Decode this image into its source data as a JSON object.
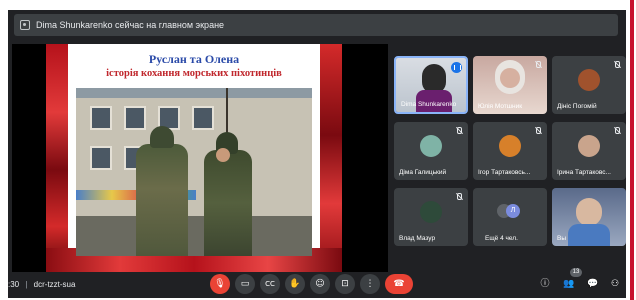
{
  "notification": {
    "text": "Dima Shunkarenko сейчас на главном экране"
  },
  "slide": {
    "title": "Руслан та Олена",
    "subtitle": "історія кохання морських піхотинців"
  },
  "participants": [
    {
      "name": "Dima Shunkarenko",
      "speaking": true
    },
    {
      "name": "Юлія Мотшник",
      "speaking": false
    },
    {
      "name": "Дініс Погомій",
      "speaking": false
    },
    {
      "name": "Діма Галицький",
      "speaking": false
    },
    {
      "name": "Ігор Тартаковсь...",
      "speaking": false
    },
    {
      "name": "Ірина Тартаковс...",
      "speaking": false
    },
    {
      "name": "Влад Мазур",
      "speaking": false
    },
    {
      "name": "Ещё 4 чел.",
      "speaking": false
    },
    {
      "name": "Вы",
      "speaking": false
    }
  ],
  "more_badge_letter": "Л",
  "meeting": {
    "time": ":30",
    "code": "dcr-tzzt-sua"
  },
  "controls": {
    "participants_count": "13"
  },
  "colors": {
    "background": "#202124",
    "tile": "#3c4043",
    "danger": "#ea4335",
    "accent": "#1a73e8"
  }
}
